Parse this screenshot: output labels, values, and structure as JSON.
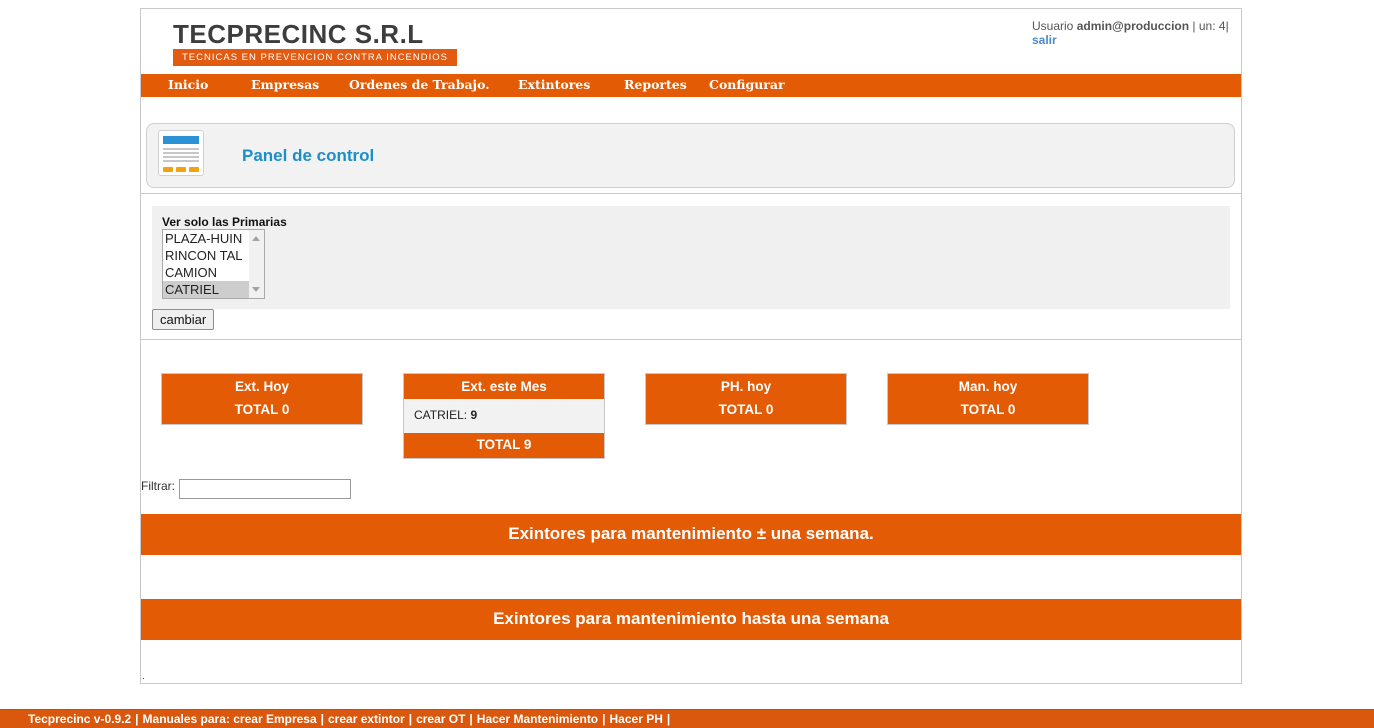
{
  "header": {
    "logo_text": "TECPRECINC S.R.L",
    "logo_subtitle": "TECNICAS EN PREVENCION CONTRA INCENDIOS",
    "user_prefix": "Usuario",
    "user_name": "admin@produccion",
    "user_suffix": "| un: 4|",
    "logout_label": "salir"
  },
  "nav": {
    "items": [
      {
        "label": "Inicio"
      },
      {
        "label": "Empresas"
      },
      {
        "label": "Ordenes de Trabajo."
      },
      {
        "label": "Extintores"
      },
      {
        "label": "Reportes"
      },
      {
        "label": "Configurar"
      }
    ]
  },
  "panel": {
    "title": "Panel de control"
  },
  "filter": {
    "label": "Ver solo las Primarias",
    "options": [
      "PLAZA-HUIN",
      "RINCON TAL",
      "CAMION",
      "CATRIEL"
    ],
    "selected": "CATRIEL",
    "button_label": "cambiar"
  },
  "cards": [
    {
      "title": "Ext. Hoy",
      "total": "TOTAL 0"
    },
    {
      "title": "Ext. este Mes",
      "row_label": "CATRIEL:",
      "row_value": "9",
      "total": "TOTAL 9"
    },
    {
      "title": "PH. hoy",
      "total": "TOTAL 0"
    },
    {
      "title": "Man. hoy",
      "total": "TOTAL 0"
    }
  ],
  "search": {
    "label": "Filtrar:",
    "value": ""
  },
  "sections": {
    "week_plus_minus": "Exintores para mantenimiento ± una semana.",
    "week_until": "Exintores para mantenimiento hasta una semana"
  },
  "footer": {
    "version": "Tecprecinc v-0.9.2",
    "manuals_label": "Manuales para:",
    "links": [
      "crear Empresa",
      "crear extintor",
      "crear OT",
      "Hacer Mantenimiento",
      "Hacer PH"
    ]
  },
  "colors": {
    "accent": "#e35b04",
    "panel_title": "#1c8fc9",
    "logout_link": "#4b89c8"
  }
}
